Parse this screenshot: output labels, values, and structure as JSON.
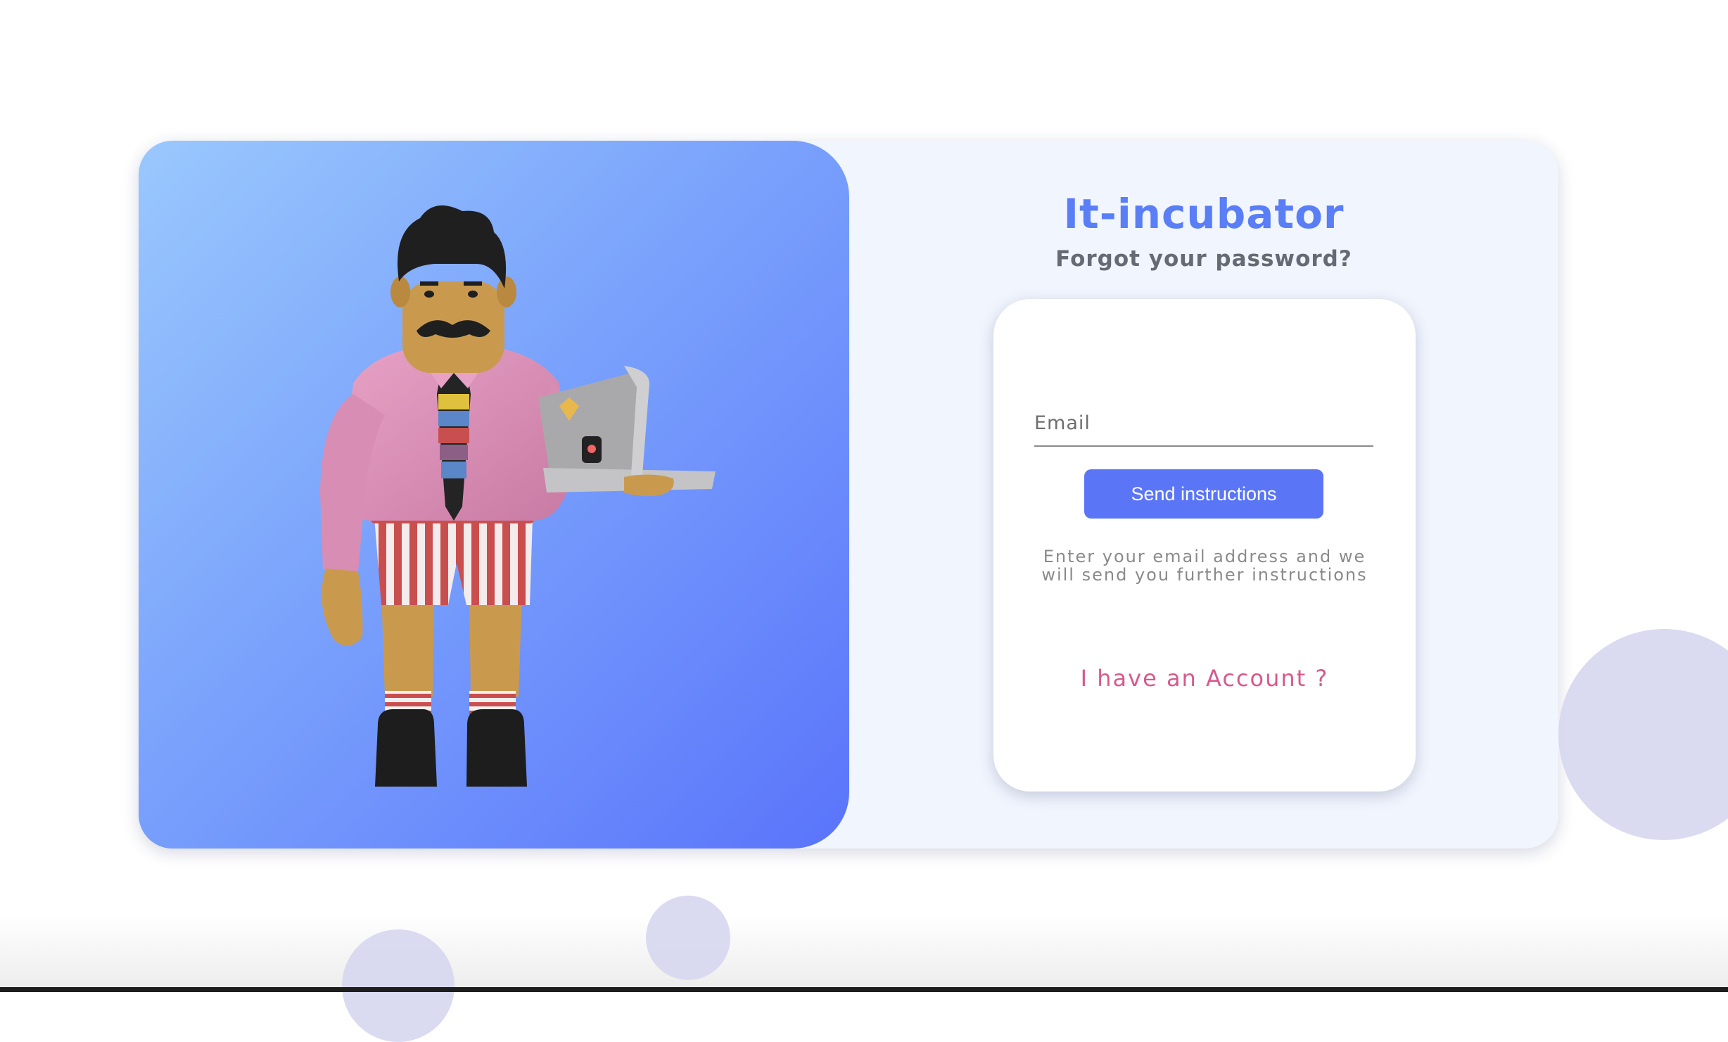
{
  "brand": {
    "title": "It-incubator"
  },
  "page": {
    "subtitle": "Forgot your password?"
  },
  "form": {
    "email": {
      "placeholder": "Email",
      "value": ""
    },
    "submit_label": "Send instructions",
    "hint": "Enter your email address and we will send you further instructions",
    "account_link": "I have an Account ?"
  },
  "illustration": {
    "icon": "man-with-laptop-illustration"
  },
  "colors": {
    "brand": "#5a7ef5",
    "button": "#5b75f7",
    "link": "#d8598d",
    "hero_gradient_start": "#9ac8fd",
    "hero_gradient_end": "#5a74fb",
    "card_background": "#f1f5fe",
    "bubble": "#d6d6f0"
  }
}
